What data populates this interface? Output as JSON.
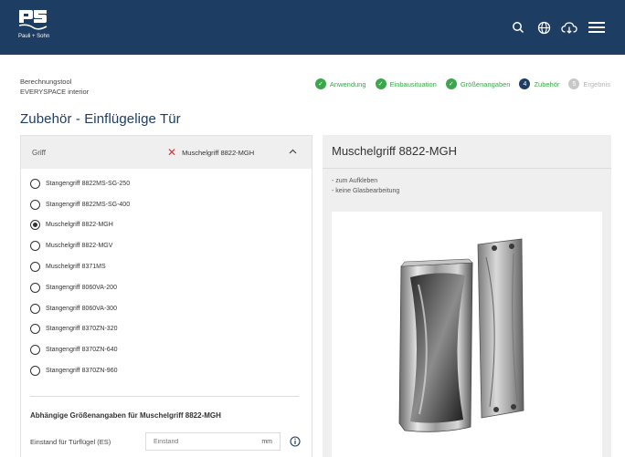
{
  "header": {
    "logo_text": "Pauli + Sohn",
    "icons": [
      "search-icon",
      "globe-icon",
      "cloud-download-icon",
      "menu-icon"
    ],
    "bg_color": "#1d3d63"
  },
  "tool": {
    "line1": "Berechnungstool",
    "line2": "EVERYSPACE interior"
  },
  "steps": [
    {
      "label": "Anwendung",
      "state": "done"
    },
    {
      "label": "Einbausituation",
      "state": "done"
    },
    {
      "label": "Größenangaben",
      "state": "done"
    },
    {
      "label": "Zubehör",
      "state": "current",
      "num": "4"
    },
    {
      "label": "Ergebnis",
      "state": "pending",
      "num": "5"
    }
  ],
  "page_title": "Zubehör - Einflügelige Tür",
  "griff": {
    "category": "Griff",
    "selected": "Muschelgriff 8822-MGH",
    "options": [
      {
        "label": "Stangengriff 8822MS-SG-250",
        "checked": false
      },
      {
        "label": "Stangengriff 8822MS-SG-400",
        "checked": false
      },
      {
        "label": "Muschelgriff 8822-MGH",
        "checked": true
      },
      {
        "label": "Muschelgriff 8822-MGV",
        "checked": false
      },
      {
        "label": "Muschelgriff 8371MS",
        "checked": false
      },
      {
        "label": "Stangengriff 8060VA-200",
        "checked": false
      },
      {
        "label": "Stangengriff 8060VA-300",
        "checked": false
      },
      {
        "label": "Stangengriff 8370ZN-320",
        "checked": false
      },
      {
        "label": "Stangengriff 8370ZN-640",
        "checked": false
      },
      {
        "label": "Stangengriff 8370ZN-960",
        "checked": false
      }
    ]
  },
  "dependent": {
    "title": "Abhängige Größenangaben für Muschelgriff 8822-MGH",
    "field_label": "Einstand für Türflügel (ES)",
    "placeholder": "Einstand",
    "value": "",
    "unit": "mm"
  },
  "product": {
    "title": "Muschelgriff 8822-MGH",
    "features": [
      "- zum Aufkleben",
      "- keine Glasbearbeitung"
    ]
  },
  "colors": {
    "accent": "#1d3d63",
    "success": "#3aa84a",
    "error": "#e03030"
  }
}
